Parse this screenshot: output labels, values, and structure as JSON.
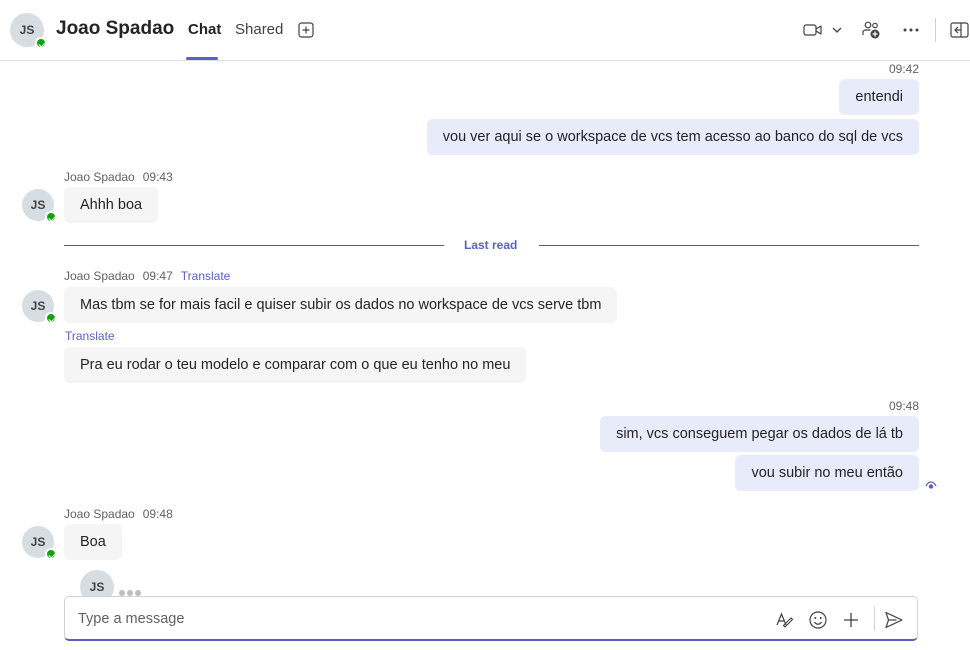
{
  "header": {
    "avatar_initials": "JS",
    "title": "Joao Spadao",
    "tabs": [
      {
        "label": "Chat",
        "active": true
      },
      {
        "label": "Shared",
        "active": false
      }
    ]
  },
  "messages": {
    "m1": {
      "time": "09:42",
      "text": "entendi"
    },
    "m2": {
      "text": "vou ver aqui se o workspace de vcs tem acesso ao banco do sql de vcs"
    },
    "m3": {
      "sender": "Joao Spadao",
      "time": "09:43",
      "text": "Ahhh boa"
    },
    "last_read_label": "Last read",
    "m4": {
      "sender": "Joao Spadao",
      "time": "09:47",
      "translate": "Translate",
      "text": "Mas tbm se for mais facil e quiser subir os dados no workspace de vcs serve tbm"
    },
    "m5": {
      "translate": "Translate",
      "text": "Pra eu rodar o teu modelo e comparar com o que eu tenho no meu"
    },
    "m6": {
      "time": "09:48",
      "text": "sim, vcs conseguem pegar os dados de lá tb"
    },
    "m7": {
      "text": "vou subir no meu então"
    },
    "m8": {
      "sender": "Joao Spadao",
      "time": "09:48",
      "text": "Boa"
    },
    "avatar_initials": "JS"
  },
  "compose": {
    "placeholder": "Type a message"
  },
  "colors": {
    "accent": "#5b5fc7",
    "outgoing_bubble": "#e8ebfa",
    "incoming_bubble": "#f5f5f5",
    "presence": "#13a10e"
  }
}
